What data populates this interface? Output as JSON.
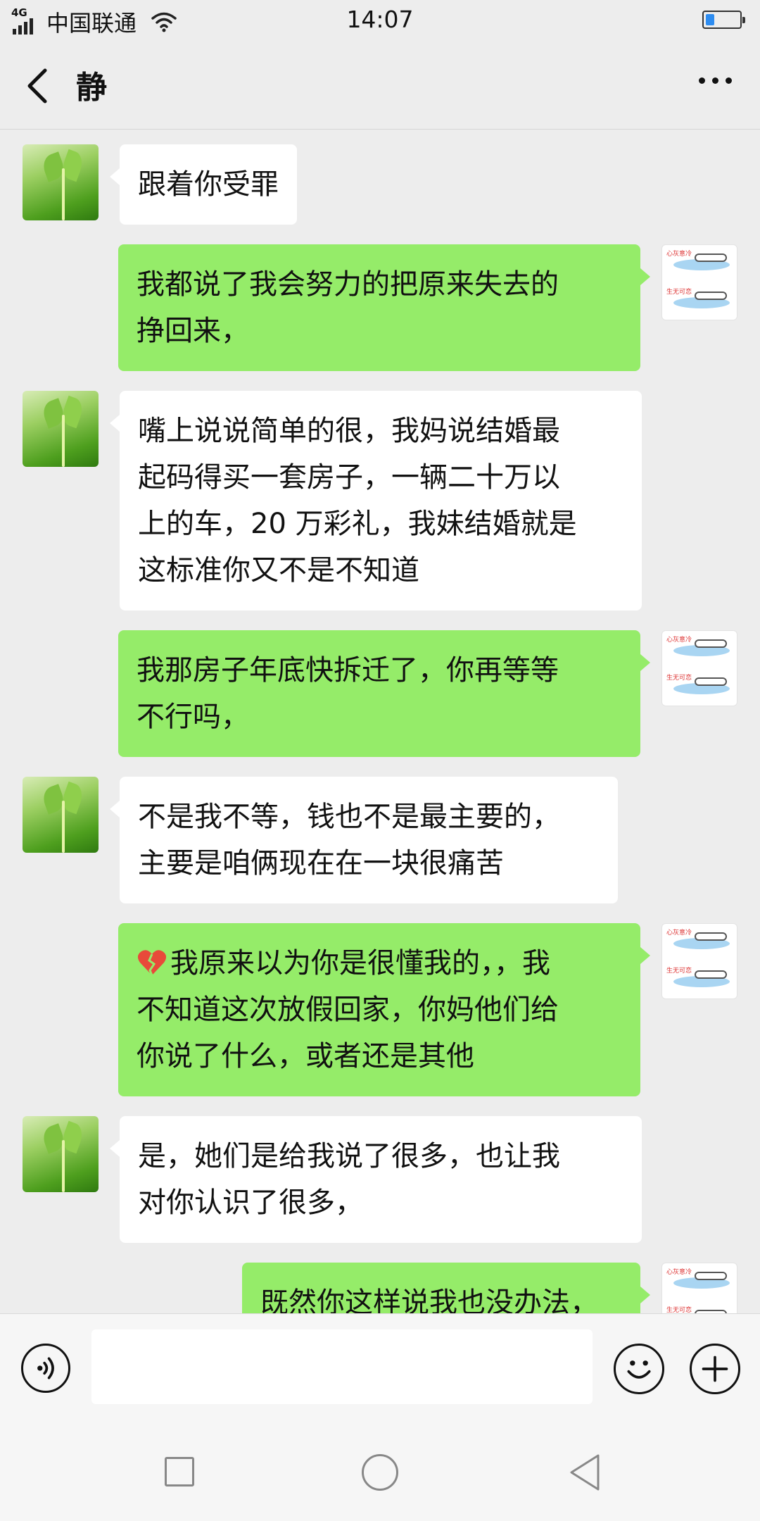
{
  "status_bar": {
    "network": "4G",
    "carrier": "中国联通",
    "time": "14:07",
    "battery_level": 0.25
  },
  "header": {
    "title": "静"
  },
  "messages": [
    {
      "side": "left",
      "text": "跟着你受罪"
    },
    {
      "side": "right",
      "text": "我都说了我会努力的把原来失去的\n挣回来，"
    },
    {
      "side": "left",
      "text": "嘴上说说简单的很，我妈说结婚最\n起码得买一套房子，一辆二十万以\n上的车，20 万彩礼，我妹结婚就是\n这标准你又不是不知道"
    },
    {
      "side": "right",
      "text": "我那房子年底快拆迁了，你再等等\n不行吗，"
    },
    {
      "side": "left",
      "text": "不是我不等，钱也不是最主要的，\n主要是咱俩现在在一块很痛苦"
    },
    {
      "side": "right",
      "emoji": "broken-heart",
      "text": "我原来以为你是很懂我的，，我\n不知道这次放假回家，你妈他们给\n你说了什么，或者还是其他"
    },
    {
      "side": "left",
      "text": "是，她们是给我说了很多，也让我\n对你认识了很多，"
    },
    {
      "side": "right",
      "text": "既然你这样说我也没办法，"
    }
  ],
  "sticker_avatar_text": [
    "心灰意冷",
    "生无可恋"
  ],
  "colors": {
    "sent_bubble": "#95ec69",
    "received_bubble": "#ffffff",
    "background": "#ededed"
  },
  "input_bar": {
    "placeholder": ""
  }
}
